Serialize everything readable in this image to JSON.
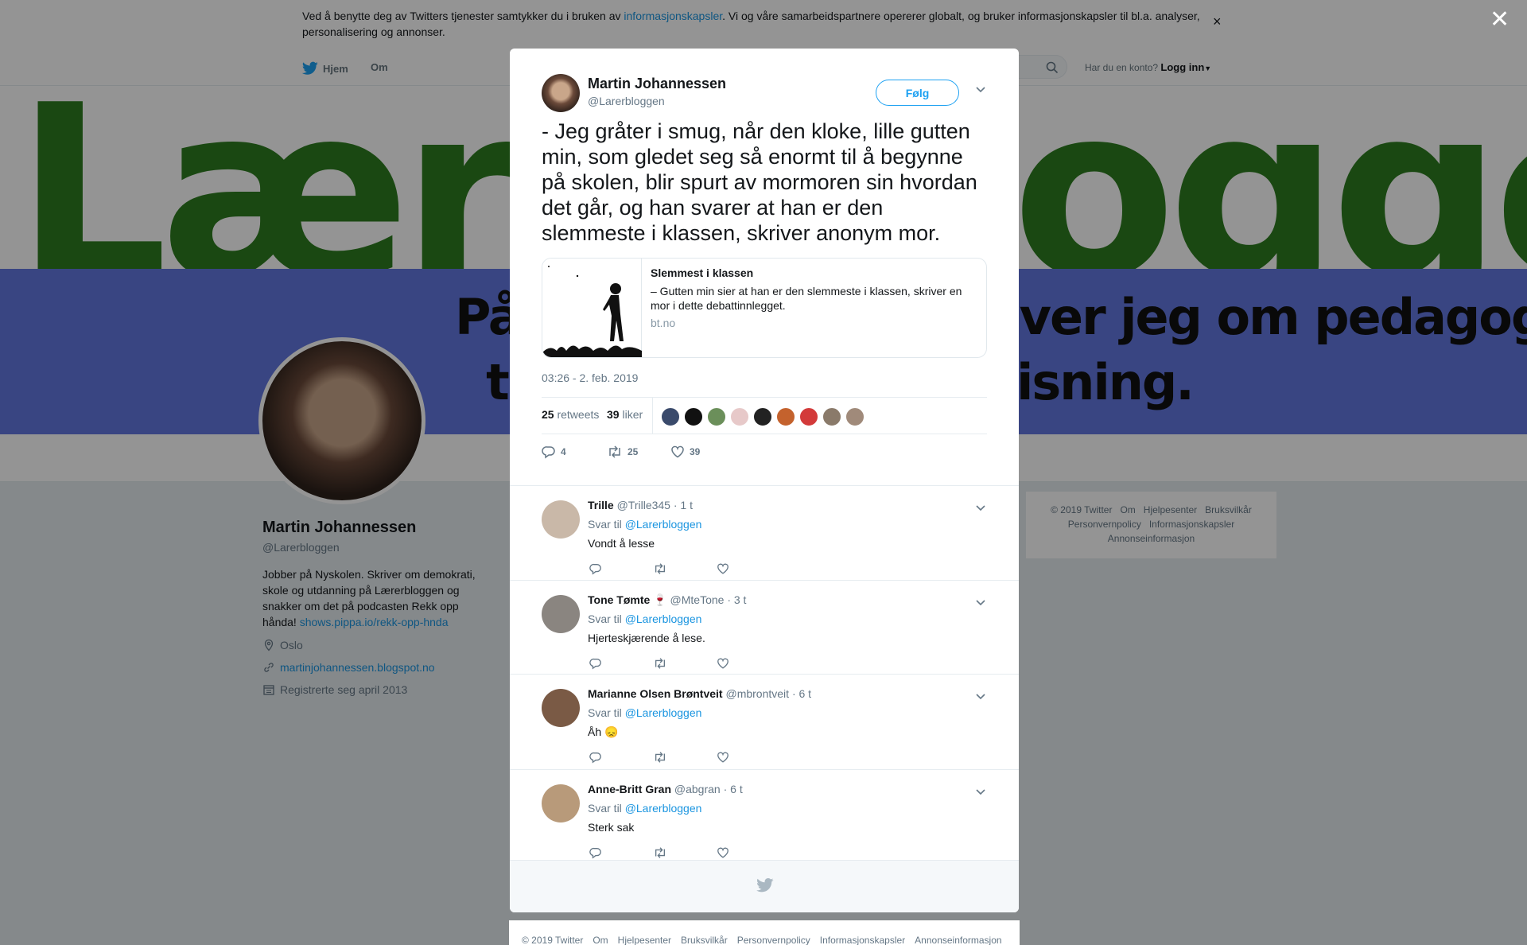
{
  "cookie": {
    "text_before": "Ved å benytte deg av Twitters tjenester samtykker du i bruken av ",
    "link": "informasjonskapsler",
    "text_after": ". Vi og våre samarbeidspartnere opererer globalt, og bruker informasjonskapsler til bl.a. analyser, personalisering og annonser.",
    "close_glyph": "×"
  },
  "nav": {
    "home": "Hjem",
    "about": "Om",
    "have_account": "Har du en konto?",
    "login": "Logg inn"
  },
  "banner": {
    "big_text": "Lærerbloggen",
    "slogan": "På Lærerbloggen skriver jeg om pedagogikk, skole,\n  teknologi og undervisning."
  },
  "profile": {
    "name": "Martin Johannessen",
    "handle": "@Larerbloggen",
    "bio": "Jobber på Nyskolen. Skriver om demokrati, skole og utdanning på Lærerbloggen og snakker om det på podcasten Rekk opp hånda! ",
    "bio_link": "shows.pippa.io/rekk-opp-hnda",
    "location": "Oslo",
    "website": "martinjohannessen.blogspot.no",
    "joined": "Registrerte seg april 2013"
  },
  "side_footer": [
    "© 2019 Twitter",
    "Om",
    "Hjelpesenter",
    "Bruksvilkår",
    "Personvernpolicy",
    "Informasjonskapsler",
    "Annonseinformasjon"
  ],
  "overlay_close": "✕",
  "tweet": {
    "author_name": "Martin Johannessen",
    "author_handle": "@Larerbloggen",
    "follow_label": "Følg",
    "text": "- Jeg gråter i smug, når den kloke, lille gutten min, som gledet seg så enormt til å begynne på skolen, blir spurt av mormoren sin hvordan det går, og han svarer at han er den slemmeste i klassen, skriver anonym mor.",
    "card": {
      "title": "Slemmest i klassen",
      "description": "– Gutten min sier at han er den slemmeste i klassen, skriver en mor i dette debattinnlegget.",
      "domain": "bt.no"
    },
    "timestamp": "03:26 - 2. feb. 2019",
    "retweets_count": "25",
    "retweets_label": "retweets",
    "likes_count": "39",
    "likes_label": "liker",
    "reply_count": "4",
    "retweet_action_count": "25",
    "like_action_count": "39",
    "liker_colors": [
      "#3a4a6b",
      "#111111",
      "#6b8f5a",
      "#e7c9c9",
      "#222222",
      "#c4622d",
      "#d33a3a",
      "#8a7a6a",
      "#a08a7a"
    ]
  },
  "replies": [
    {
      "name": "Trille",
      "handle": "@Trille345",
      "time": "· 1 t",
      "to_prefix": "Svar til ",
      "to_handle": "@Larerbloggen",
      "text": "Vondt å lesse",
      "avatar_color": "#c9b8a8"
    },
    {
      "name": "Tone Tømte 🍷",
      "handle": "@MteTone",
      "time": "· 3 t",
      "to_prefix": "Svar til ",
      "to_handle": "@Larerbloggen",
      "text": "Hjerteskjærende å lese.",
      "avatar_color": "#8a8580"
    },
    {
      "name": "Marianne Olsen Brøntveit",
      "handle": "@mbrontveit",
      "time": "· 6 t",
      "to_prefix": "Svar til ",
      "to_handle": "@Larerbloggen",
      "text": "Åh 😞",
      "avatar_color": "#7a5a45"
    },
    {
      "name": "Anne-Britt Gran",
      "handle": "@abgran",
      "time": "· 6 t",
      "to_prefix": "Svar til ",
      "to_handle": "@Larerbloggen",
      "text": "Sterk sak",
      "avatar_color": "#b89a7a"
    }
  ],
  "bottom_footer": [
    "© 2019 Twitter",
    "Om",
    "Hjelpesenter",
    "Bruksvilkår",
    "Personvernpolicy",
    "Informasjonskapsler",
    "Annonseinformasjon"
  ],
  "colors": {
    "accent": "#1da1f2",
    "link": "#1b95e0",
    "banner_blue": "#6377e0",
    "banner_green": "#2e7d1f"
  }
}
